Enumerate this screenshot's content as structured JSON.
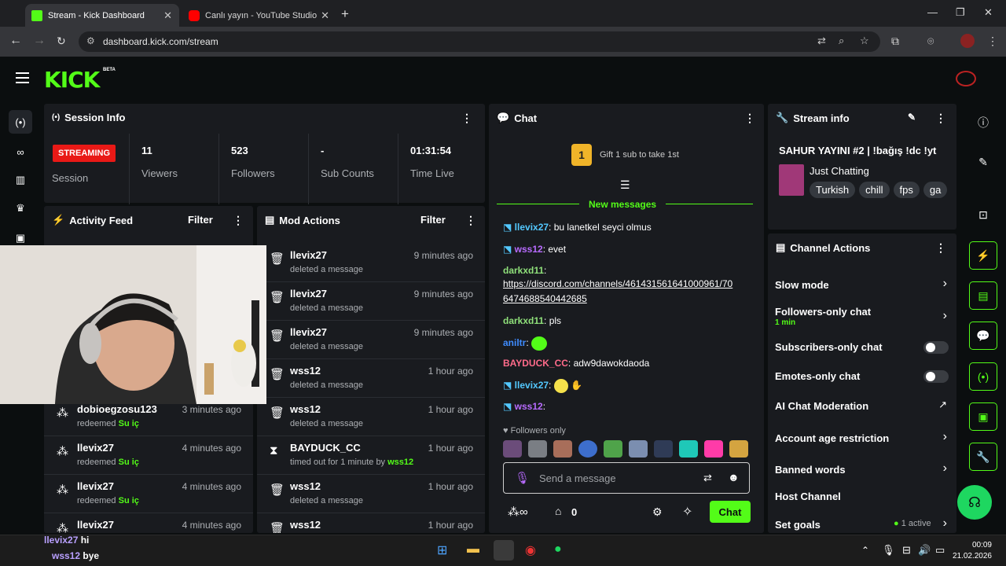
{
  "browser": {
    "tabs": [
      {
        "title": "Stream - Kick Dashboard",
        "active": true
      },
      {
        "title": "Canlı yayın - YouTube Studio",
        "active": false
      }
    ],
    "url": "dashboard.kick.com/stream"
  },
  "header": {
    "logo": "KICK",
    "beta": "BETA"
  },
  "session": {
    "title": "Session Info",
    "status": "STREAMING",
    "status_label": "Session",
    "viewers": {
      "value": "11",
      "label": "Viewers"
    },
    "followers": {
      "value": "523",
      "label": "Followers"
    },
    "subs": {
      "value": "-",
      "label": "Sub Counts"
    },
    "time": {
      "value": "01:31:54",
      "label": "Time Live"
    }
  },
  "activity": {
    "title": "Activity Feed",
    "filter": "Filter",
    "rows": [
      {
        "user": "dobioegzosu123",
        "action": "redeemed",
        "item": "Su iç",
        "time": "3 minutes ago"
      },
      {
        "user": "llevix27",
        "action": "redeemed",
        "item": "Su iç",
        "time": "4 minutes ago"
      },
      {
        "user": "llevix27",
        "action": "redeemed",
        "item": "Su iç",
        "time": "4 minutes ago"
      },
      {
        "user": "llevix27",
        "action": "",
        "item": "",
        "time": "4 minutes ago"
      }
    ]
  },
  "mod": {
    "title": "Mod Actions",
    "filter": "Filter",
    "rows": [
      {
        "user": "llevix27",
        "action": "deleted a message",
        "time": "9 minutes ago"
      },
      {
        "user": "llevix27",
        "action": "deleted a message",
        "time": "9 minutes ago"
      },
      {
        "user": "llevix27",
        "action": "deleted a message",
        "time": "9 minutes ago"
      },
      {
        "user": "wss12",
        "action": "deleted a message",
        "time": "1 hour ago"
      },
      {
        "user": "wss12",
        "action": "deleted a message",
        "time": "1 hour ago"
      },
      {
        "user": "BAYDUCK_CC",
        "action": "timed out for 1 minute by",
        "by": "wss12",
        "time": "1 hour ago"
      },
      {
        "user": "wss12",
        "action": "deleted a message",
        "time": "1 hour ago"
      },
      {
        "user": "wss12",
        "action": "",
        "time": "1 hour ago"
      }
    ]
  },
  "chat": {
    "title": "Chat",
    "gift": "Gift 1 sub to take 1st",
    "gift_count": "1",
    "new_messages": "New messages",
    "messages": [
      {
        "user": "llevix27",
        "text": "bu lanetkel seyci olmus",
        "color": "#53c8ff"
      },
      {
        "user": "wss12",
        "text": "evet",
        "color": "#b86bff"
      },
      {
        "user": "darkxd11",
        "text": "",
        "color": "#8fe07a"
      },
      {
        "user": "",
        "text": "https://discord.com/channels/461431561641000961/70",
        "color": "#fff"
      },
      {
        "user": "",
        "text": "6474688540442685",
        "color": "#fff"
      },
      {
        "user": "darkxd11",
        "text": "pls",
        "color": "#8fe07a"
      },
      {
        "user": "aniltr",
        "text": "",
        "color": "#3f8cff"
      },
      {
        "user": "BAYDUCK_CC",
        "text": "adw9dawokdaoda",
        "color": "#ff6b8a"
      },
      {
        "user": "llevix27",
        "text": "",
        "color": "#53c8ff"
      },
      {
        "user": "wss12",
        "text": "",
        "color": "#b86bff"
      }
    ],
    "followers_only": "Followers only",
    "placeholder": "Send a message",
    "points": "0",
    "send": "Chat"
  },
  "stream": {
    "title": "Stream info",
    "stream_title": "SAHUR YAYINI #2 | !bağış !dc !yt",
    "category": "Just Chatting",
    "tags": [
      "Turkish",
      "chill",
      "fps",
      "ga"
    ]
  },
  "channel": {
    "title": "Channel Actions",
    "items": [
      {
        "label": "Slow mode"
      },
      {
        "label": "Followers-only chat",
        "sub": "1 min"
      },
      {
        "label": "Subscribers-only chat"
      },
      {
        "label": "Emotes-only chat"
      },
      {
        "label": "AI Chat Moderation"
      },
      {
        "label": "Account age restriction"
      },
      {
        "label": "Banned words"
      },
      {
        "label": "Host Channel"
      },
      {
        "label": "Set goals",
        "status": "1 active"
      }
    ]
  },
  "overlay_chat": [
    {
      "user": "llevix27",
      "text": "hi"
    },
    {
      "user": "wss12",
      "text": "bye"
    }
  ],
  "taskbar": {
    "time": "00:09",
    "date": "21.02.2026"
  },
  "colors": {
    "accent": "#53fc18",
    "bg": "#0b0e0f",
    "panel": "#191b1f",
    "live": "#e91916"
  }
}
